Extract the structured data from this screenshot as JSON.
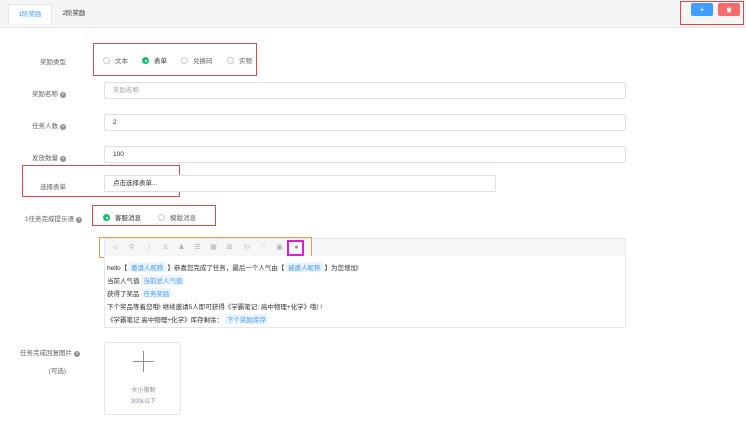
{
  "tabs": [
    {
      "label": "1阶奖励",
      "active": true
    },
    {
      "label": "2阶奖励",
      "active": false
    }
  ],
  "header_buttons": {
    "add": "+",
    "delete": "⌫"
  },
  "form": {
    "reward_type": {
      "label": "奖励类型",
      "options": [
        {
          "label": "文本",
          "checked": false
        },
        {
          "label": "表单",
          "checked": true
        },
        {
          "label": "兑换码",
          "checked": false
        },
        {
          "label": "实物",
          "checked": false
        }
      ]
    },
    "reward_name": {
      "label": "奖励名称",
      "placeholder": "奖励名称"
    },
    "task_count": {
      "label": "任务人数",
      "value": "2"
    },
    "issue_count": {
      "label": "发放数量",
      "value": "100"
    },
    "select_form": {
      "label": "选择表单",
      "value": "点击选择表单..."
    },
    "completion_tip": {
      "label": "1任务完成提示语",
      "options": [
        {
          "label": "客服消息",
          "checked": true
        },
        {
          "label": "模版消息",
          "checked": false
        }
      ]
    },
    "editor": {
      "toolbar_icons": [
        "smile-icon",
        "link-icon",
        "divider-icon",
        "user-icon",
        "users-icon",
        "list-icon",
        "calendar-icon",
        "gift-icon",
        "clock-icon",
        "heart-icon",
        "image-icon",
        "circle-icon"
      ],
      "lines": [
        {
          "parts": [
            {
              "text": "hello【 ",
              "tag": false
            },
            {
              "text": "邀请人昵称",
              "tag": true
            },
            {
              "text": " 】恭喜您完成了任务，最后一个人气由【 ",
              "tag": false
            },
            {
              "text": "被邀人昵称",
              "tag": true
            },
            {
              "text": " 】为您增加!",
              "tag": false
            }
          ]
        },
        {
          "parts": [
            {
              "text": "当前人气值 ",
              "tag": false
            },
            {
              "text": "当前总人气值",
              "tag": true
            }
          ]
        },
        {
          "parts": [
            {
              "text": "获得了奖品 ",
              "tag": false
            },
            {
              "text": "任务奖励",
              "tag": true
            }
          ]
        },
        {
          "parts": [
            {
              "text": "下个奖品等着您哦! 继续邀请5人即可获得《学霸笔记: 高中物理+化学》哦! !",
              "tag": false
            }
          ]
        },
        {
          "parts": [
            {
              "text": "《学霸笔记 高中物理+化学》库存剩余： ",
              "tag": false
            },
            {
              "text": "下个奖励库存",
              "tag": true
            }
          ]
        }
      ]
    },
    "reply_image": {
      "label": "任务完成回复图片",
      "sublabel": "(可选)",
      "hint1": "大小限制",
      "hint2": "300k以下"
    }
  },
  "colors": {
    "primary": "#409eff",
    "danger": "#f56c6c",
    "success": "#13c26b",
    "annotation_red": "#e64545",
    "annotation_orange": "#f29a3e",
    "annotation_magenta": "#d61fd6"
  }
}
